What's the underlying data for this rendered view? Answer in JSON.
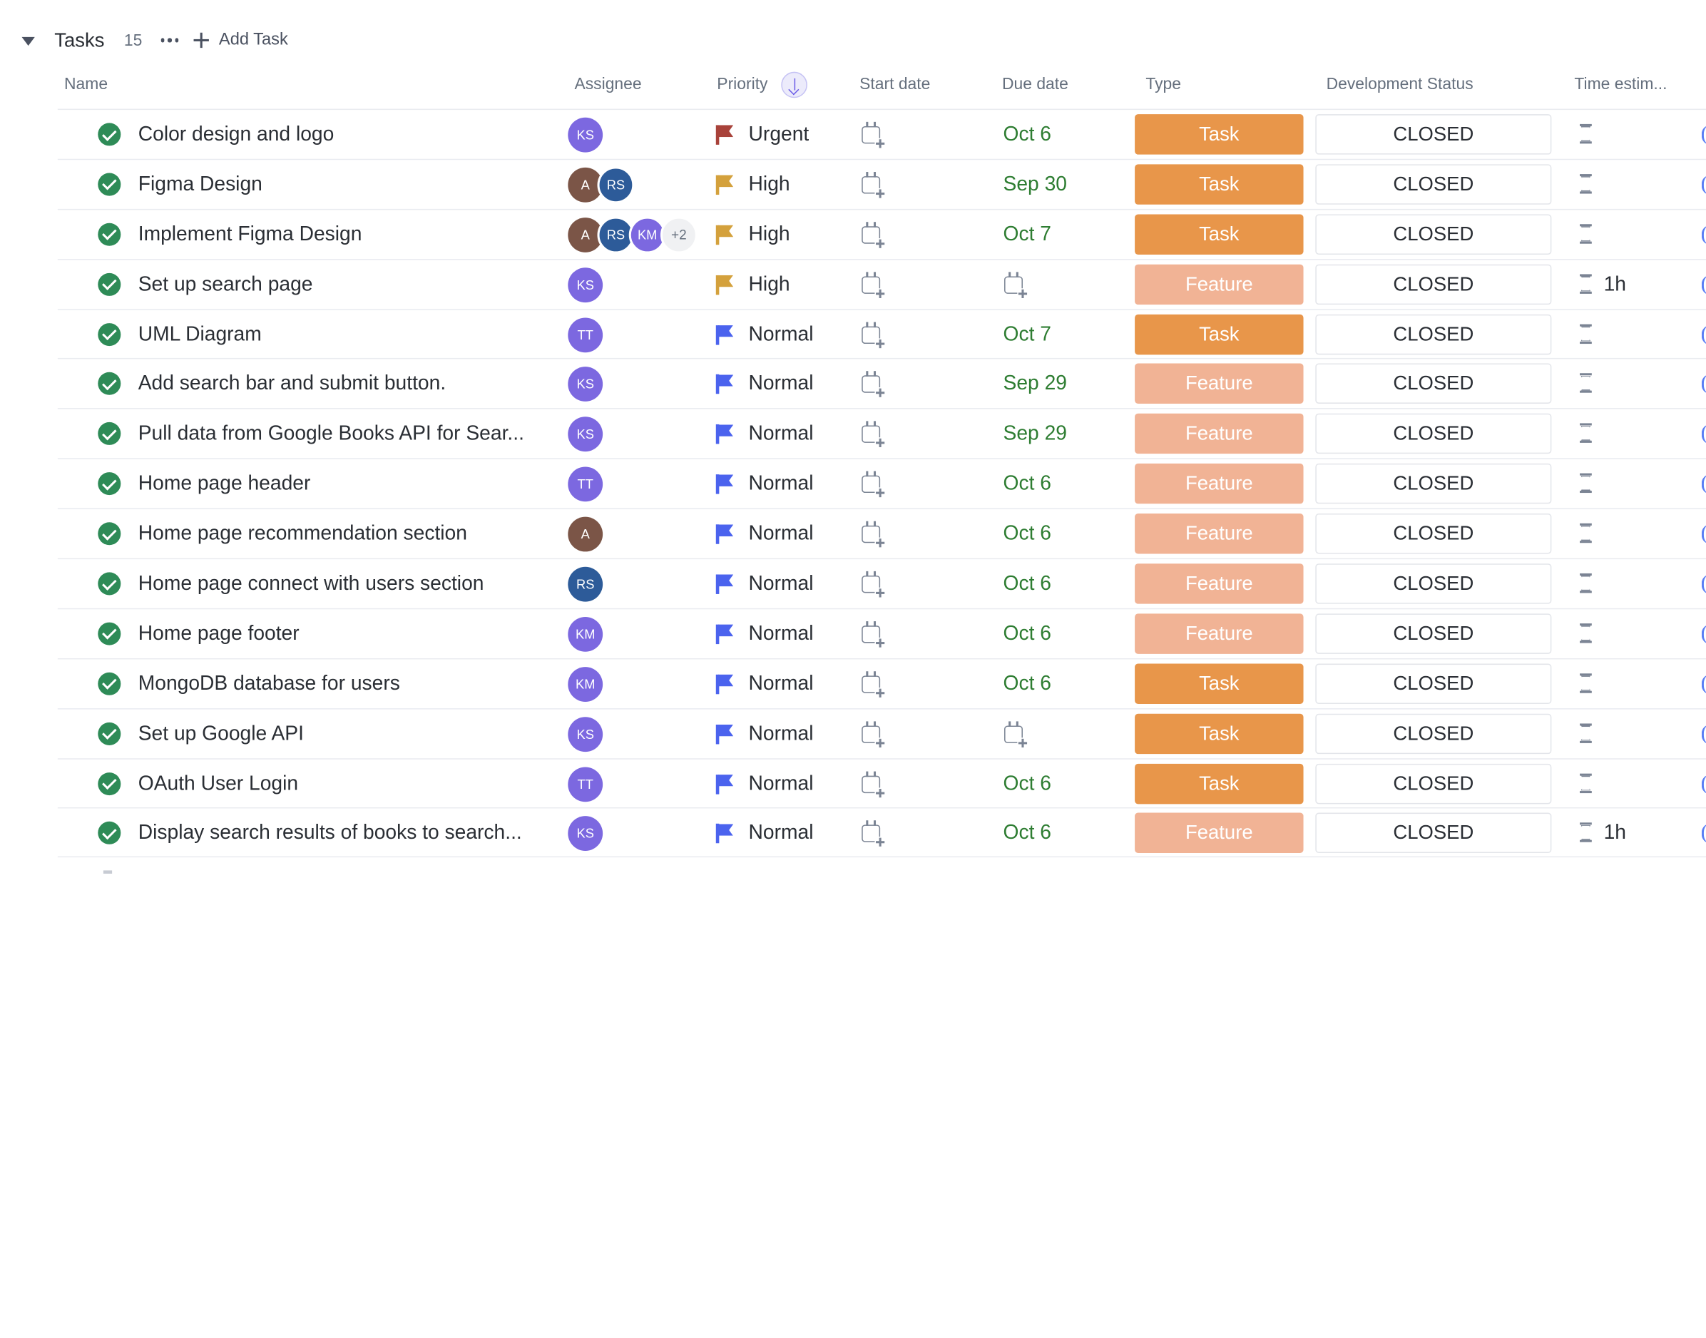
{
  "group": {
    "title": "Tasks",
    "count": "15",
    "add_task_label": "Add Task"
  },
  "columns": {
    "name": "Name",
    "assignee": "Assignee",
    "priority": "Priority",
    "start_date": "Start date",
    "due_date": "Due date",
    "type": "Type",
    "development_status": "Development Status",
    "time_estimate": "Time estim..."
  },
  "sort": {
    "column": "priority",
    "direction": "descending",
    "icon": "arrow-down-icon"
  },
  "colors": {
    "done_check": "#2e8b57",
    "urgent_flag": "#a8423a",
    "high_flag": "#d4a13c",
    "normal_flag": "#4b63ee",
    "due_date_text": "#2e7d32",
    "type_task": "#e8964a",
    "type_feature": "#f1b395",
    "avatar_ks": "#7c68e0",
    "avatar_tt": "#7c68e0",
    "avatar_km": "#7c68e0",
    "avatar_a": "#7b5547",
    "avatar_rs": "#2d5b99"
  },
  "tasks": [
    {
      "name": "Color design and logo",
      "assignees": [
        "KS"
      ],
      "extra": "",
      "priority": "Urgent",
      "start_date": "",
      "due_date": "Oct 6",
      "type": "Task",
      "status": "CLOSED",
      "time_estimate": ""
    },
    {
      "name": "Figma Design",
      "assignees": [
        "A",
        "RS"
      ],
      "extra": "",
      "priority": "High",
      "start_date": "",
      "due_date": "Sep 30",
      "type": "Task",
      "status": "CLOSED",
      "time_estimate": ""
    },
    {
      "name": "Implement Figma Design",
      "assignees": [
        "A",
        "RS",
        "KM"
      ],
      "extra": "+2",
      "priority": "High",
      "start_date": "",
      "due_date": "Oct 7",
      "type": "Task",
      "status": "CLOSED",
      "time_estimate": ""
    },
    {
      "name": "Set up search page",
      "assignees": [
        "KS"
      ],
      "extra": "",
      "priority": "High",
      "start_date": "",
      "due_date": "",
      "type": "Feature",
      "status": "CLOSED",
      "time_estimate": "1h"
    },
    {
      "name": "UML Diagram",
      "assignees": [
        "TT"
      ],
      "extra": "",
      "priority": "Normal",
      "start_date": "",
      "due_date": "Oct 7",
      "type": "Task",
      "status": "CLOSED",
      "time_estimate": ""
    },
    {
      "name": "Add search bar and submit button.",
      "assignees": [
        "KS"
      ],
      "extra": "",
      "priority": "Normal",
      "start_date": "",
      "due_date": "Sep 29",
      "type": "Feature",
      "status": "CLOSED",
      "time_estimate": ""
    },
    {
      "name": "Pull data from Google Books API for Sear...",
      "assignees": [
        "KS"
      ],
      "extra": "",
      "priority": "Normal",
      "start_date": "",
      "due_date": "Sep 29",
      "type": "Feature",
      "status": "CLOSED",
      "time_estimate": ""
    },
    {
      "name": "Home page header",
      "assignees": [
        "TT"
      ],
      "extra": "",
      "priority": "Normal",
      "start_date": "",
      "due_date": "Oct 6",
      "type": "Feature",
      "status": "CLOSED",
      "time_estimate": ""
    },
    {
      "name": "Home page recommendation section",
      "assignees": [
        "A"
      ],
      "extra": "",
      "priority": "Normal",
      "start_date": "",
      "due_date": "Oct 6",
      "type": "Feature",
      "status": "CLOSED",
      "time_estimate": ""
    },
    {
      "name": "Home page connect with users section",
      "assignees": [
        "RS"
      ],
      "extra": "",
      "priority": "Normal",
      "start_date": "",
      "due_date": "Oct 6",
      "type": "Feature",
      "status": "CLOSED",
      "time_estimate": ""
    },
    {
      "name": "Home page footer",
      "assignees": [
        "KM"
      ],
      "extra": "",
      "priority": "Normal",
      "start_date": "",
      "due_date": "Oct 6",
      "type": "Feature",
      "status": "CLOSED",
      "time_estimate": ""
    },
    {
      "name": "MongoDB database for users",
      "assignees": [
        "KM"
      ],
      "extra": "",
      "priority": "Normal",
      "start_date": "",
      "due_date": "Oct 6",
      "type": "Task",
      "status": "CLOSED",
      "time_estimate": ""
    },
    {
      "name": "Set up Google API",
      "assignees": [
        "KS"
      ],
      "extra": "",
      "priority": "Normal",
      "start_date": "",
      "due_date": "",
      "type": "Task",
      "status": "CLOSED",
      "time_estimate": ""
    },
    {
      "name": "OAuth User Login",
      "assignees": [
        "TT"
      ],
      "extra": "",
      "priority": "Normal",
      "start_date": "",
      "due_date": "Oct 6",
      "type": "Task",
      "status": "CLOSED",
      "time_estimate": ""
    },
    {
      "name": "Display search results of books to search...",
      "assignees": [
        "KS"
      ],
      "extra": "",
      "priority": "Normal",
      "start_date": "",
      "due_date": "Oct 6",
      "type": "Feature",
      "status": "CLOSED",
      "time_estimate": "1h"
    }
  ]
}
